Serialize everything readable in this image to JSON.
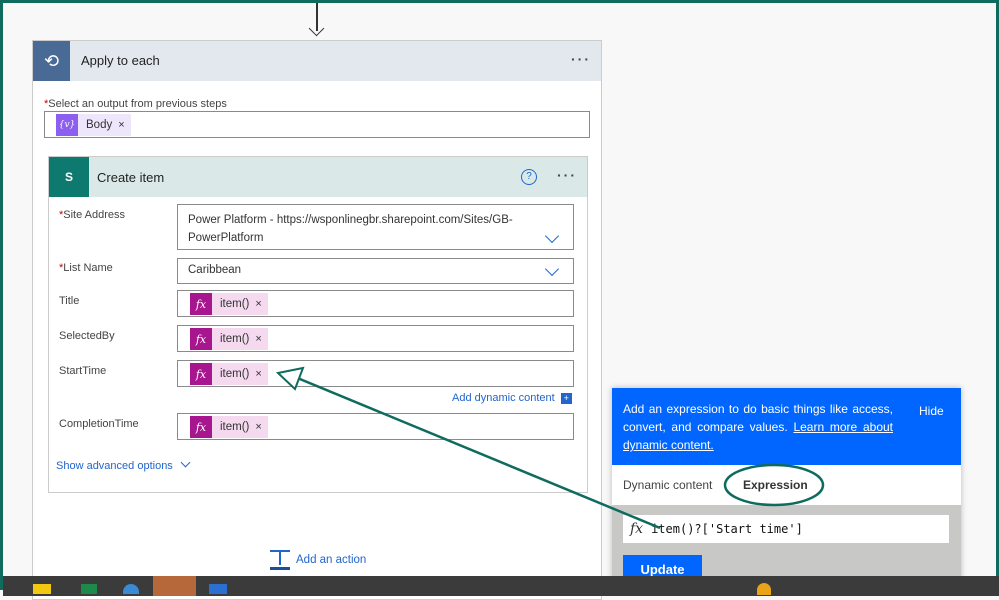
{
  "apply": {
    "title": "Apply to each",
    "select_label": "Select an output from previous steps",
    "token": "Body"
  },
  "create": {
    "title": "Create item",
    "fields": [
      {
        "label": "Site Address",
        "required": true,
        "value": "Power Platform - https://wsponlinegbr.sharepoint.com/Sites/GB-PowerPlatform"
      },
      {
        "label": "List Name",
        "required": true,
        "value": "Caribbean"
      },
      {
        "label": "Title",
        "token": "item()"
      },
      {
        "label": "SelectedBy",
        "token": "item()"
      },
      {
        "label": "StartTime",
        "token": "item()"
      },
      {
        "label": "CompletionTime",
        "token": "item()"
      }
    ],
    "add_dynamic": "Add dynamic content",
    "advanced": "Show advanced options"
  },
  "add_action": "Add an action",
  "popup": {
    "info": "Add an expression to do basic things like access, convert, and compare values.",
    "learn_more": "Learn more about dynamic content.",
    "hide": "Hide",
    "tabs": [
      "Dynamic content",
      "Expression"
    ],
    "expression": "item()?['Start time']",
    "update": "Update"
  },
  "colors": {
    "accent": "#0066ff",
    "annotation": "#0f6b5e",
    "token": "#a8168f"
  }
}
